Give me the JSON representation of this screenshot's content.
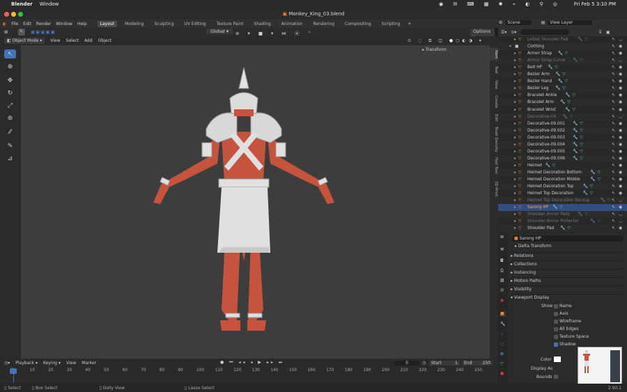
{
  "macbar": {
    "apple": "",
    "app": "Blender",
    "menu": "Window",
    "datetime": "Fri Feb 5  3:10 PM"
  },
  "titlebar": {
    "title": "Monkey_King_03.blend"
  },
  "menu": {
    "items": [
      "File",
      "Edit",
      "Render",
      "Window",
      "Help"
    ],
    "workspaces": [
      "Layout",
      "Modeling",
      "Sculpting",
      "UV Editing",
      "Texture Paint",
      "Shading",
      "Animation",
      "Rendering",
      "Compositing",
      "Scripting"
    ],
    "active": "Layout",
    "add": "+"
  },
  "header": {
    "transform_orientation": "Global",
    "options": "Options",
    "scene": "Scene",
    "view_layer": "View Layer"
  },
  "viewport": {
    "mode": "Object Mode",
    "menus": [
      "View",
      "Select",
      "Add",
      "Object"
    ],
    "transform_panel": "Transform"
  },
  "sidetabs": [
    "Item",
    "Tool",
    "View",
    "Create",
    "Edit",
    "Texel Density",
    "Hair Tool",
    "3D-Print"
  ],
  "outliner": {
    "rows": [
      {
        "name": "Lefbat Shoulder Pad",
        "dim": true
      },
      {
        "name": "Clothing",
        "collection": true
      },
      {
        "name": "Armor Strap"
      },
      {
        "name": "Armor Strap Curve",
        "dim": true
      },
      {
        "name": "Belt HP"
      },
      {
        "name": "Bezier Arm"
      },
      {
        "name": "Bezier Hand"
      },
      {
        "name": "Bezier Leg"
      },
      {
        "name": "Bracelet Ankle"
      },
      {
        "name": "Bracelet Arm"
      },
      {
        "name": "Bracelet Wrist"
      },
      {
        "name": "Decorative-04",
        "dim": true
      },
      {
        "name": "Decorative-09.001"
      },
      {
        "name": "Decorative-09.002"
      },
      {
        "name": "Decorative-09.003"
      },
      {
        "name": "Decorative-09.004"
      },
      {
        "name": "Decorative-09.005"
      },
      {
        "name": "Decorative-09.006"
      },
      {
        "name": "Helmet"
      },
      {
        "name": "Helmet Decoration Bottom"
      },
      {
        "name": "Helmet Decoration Middle"
      },
      {
        "name": "Helmet Decoration Top"
      },
      {
        "name": "Helmet Top Decoration"
      },
      {
        "name": "Helmet Top Decoration Backup",
        "dim": true
      },
      {
        "name": "Sarong HP",
        "selected": true
      },
      {
        "name": "Shoulder Armor Pads",
        "dim": true
      },
      {
        "name": "Shoulder Armor Protector",
        "dim": true
      },
      {
        "name": "Shoulder Pad"
      }
    ]
  },
  "properties": {
    "object": "Sarong HP",
    "sections": [
      "Delta Transform",
      "Relations",
      "Collections",
      "Instancing",
      "Motion Paths",
      "Visibility",
      "Viewport Display"
    ],
    "show_label": "Show",
    "show_items": [
      "Name",
      "Axis",
      "Wireframe",
      "All Edges",
      "Texture Space",
      "Shadow"
    ],
    "color_label": "Color",
    "display_as_label": "Display As",
    "bounds_label": "Bounds"
  },
  "timeline": {
    "menus": [
      "Playback",
      "Keying",
      "View",
      "Marker"
    ],
    "current_frame": "0",
    "start_label": "Start",
    "start": "1",
    "end_label": "End",
    "end": "250",
    "ticks": [
      "0",
      "10",
      "20",
      "30",
      "40",
      "50",
      "60",
      "70",
      "80",
      "90",
      "100",
      "110",
      "120",
      "130",
      "140",
      "150",
      "160",
      "170",
      "180",
      "190",
      "200",
      "210",
      "220",
      "230",
      "240",
      "250"
    ]
  },
  "statusbar": {
    "items": [
      "Select",
      "Box Select",
      "Dolly View",
      "Lasso Select"
    ],
    "version": "2.90.1"
  },
  "colors": {
    "skin": "#c5533d",
    "cloth": "#e0e0e0",
    "accent": "#4772b3",
    "orange": "#e8883a"
  }
}
